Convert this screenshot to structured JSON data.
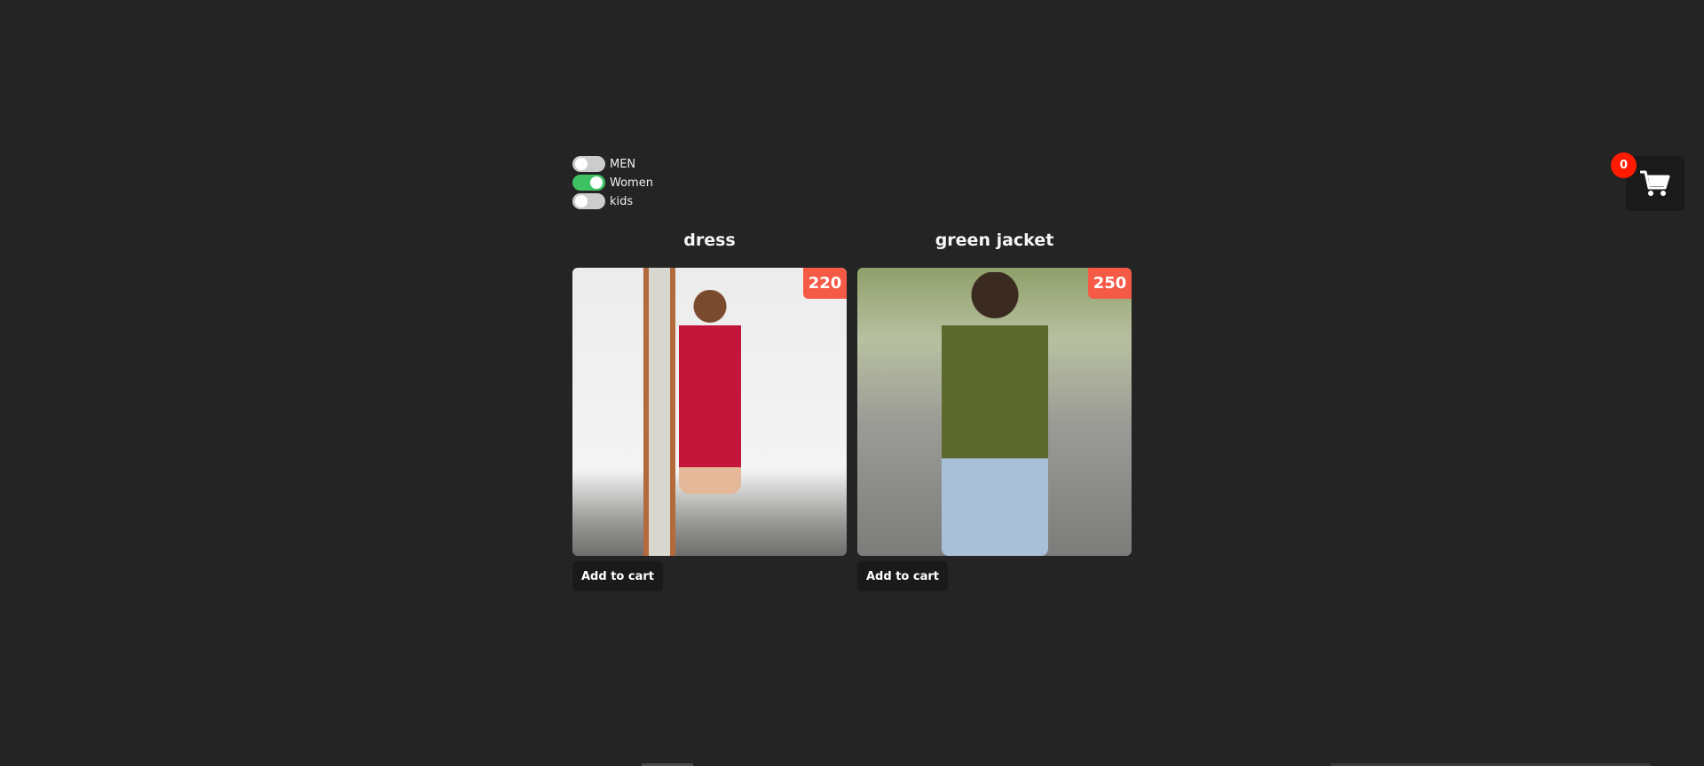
{
  "filters": [
    {
      "label": "MEN",
      "checked": false
    },
    {
      "label": "Women",
      "checked": true
    },
    {
      "label": "kids",
      "checked": false
    }
  ],
  "products": [
    {
      "title": "dress",
      "price": "220",
      "button_label": "Add to cart",
      "image": "woman in red floral dress"
    },
    {
      "title": "green jacket",
      "price": "250",
      "button_label": "Add to cart",
      "image": "woman in green jacket and jeans"
    }
  ],
  "cart": {
    "count": "0",
    "icon": "shopping-cart-icon"
  },
  "colors": {
    "background": "#242424",
    "toggle_on": "#3ec160",
    "price_badge": "#f55a46",
    "cart_badge": "#ff1a00"
  }
}
